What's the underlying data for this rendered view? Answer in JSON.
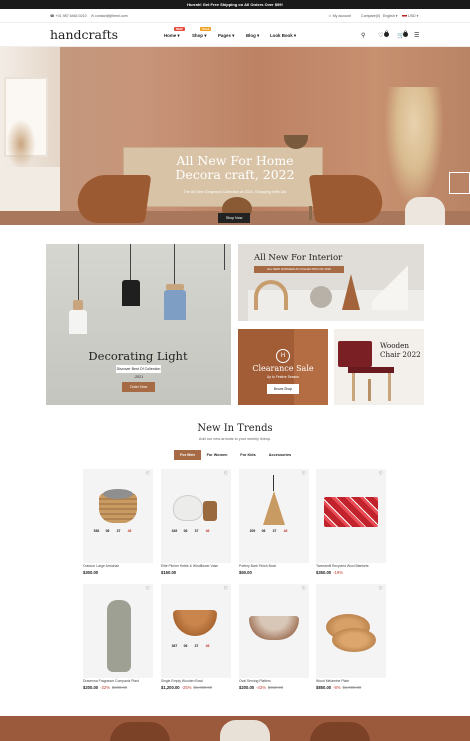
{
  "announcement": "Hurrah! Get Free Shipping on All Orders Over $99!",
  "utility": {
    "phone": "+01 987 6464 0210",
    "email": "contact@jthemi.com",
    "account": "My account",
    "compare": "Compare(0)",
    "language": "English",
    "currency": "USD"
  },
  "header": {
    "logo": "handcrafts",
    "nav": [
      {
        "label": "Home",
        "badge": "NEW",
        "badge_color": "#e74c3c"
      },
      {
        "label": "Shop",
        "badge": "SALE",
        "badge_color": "#f0a020"
      },
      {
        "label": "Pages",
        "badge": ""
      },
      {
        "label": "Blog",
        "badge": ""
      },
      {
        "label": "Look Book",
        "badge": ""
      }
    ],
    "wishlist_count": "0",
    "cart_count": "0"
  },
  "hero": {
    "title": "All New For Home Decora craft, 2022",
    "subtitle": "The All New Gorgeous Collection of 2021, Shopping With Us!",
    "button": "Shop Now"
  },
  "banners": {
    "lighting": {
      "title": "Decorating Light",
      "subtitle": "Discover Best Of Collection -2021",
      "button": "Order Now"
    },
    "interior": {
      "title": "All New For Interior",
      "subtitle": "ALL NEW GORGEOUS COLLECTION OF 2022"
    },
    "clearance": {
      "title": "Clearance Sale",
      "subtitle": "Up to Festive Season",
      "button": "Brows Shop",
      "logo": "H"
    },
    "chair": {
      "title": "Wooden Chair 2022"
    }
  },
  "trends": {
    "title": "New In Trends",
    "subtitle": "Add our new arrivals to your weekly lineup.",
    "tabs": [
      "For Men",
      "For Women",
      "For Kids",
      "Accessories"
    ],
    "active_tab": "For Men",
    "accent": "#a66b44"
  },
  "products": [
    {
      "name": "Outdoor Large Armchair",
      "price": "$300.00",
      "old_price": "",
      "discount": "",
      "countdown": [
        "536",
        "06",
        "37",
        "46"
      ]
    },
    {
      "name": "Elite Pitcher Kettle & Windflower Vase",
      "price": "$150.00",
      "old_price": "",
      "discount": "",
      "countdown": [
        "349",
        "06",
        "37",
        "46"
      ]
    },
    {
      "name": "Pottery Bark Finish Bowl",
      "price": "$50.00",
      "old_price": "",
      "discount": "",
      "countdown": [
        "209",
        "06",
        "37",
        "46"
      ]
    },
    {
      "name": "Tweedmill Recycled Wool Blankets",
      "price": "$350.00",
      "old_price": "",
      "discount": "-19%",
      "countdown": []
    },
    {
      "name": "Dravenna Fragrance Compacts Plant",
      "price": "$200.00",
      "old_price": "$300.00",
      "discount": "-32%",
      "countdown": []
    },
    {
      "name": "Single Empty Wooden Bowl",
      "price": "$1,200.00",
      "old_price": "$1,600.00",
      "discount": "-25%",
      "countdown": [
        "367",
        "06",
        "37",
        "46"
      ]
    },
    {
      "name": "Oval Serving Platters",
      "price": "$200.00",
      "old_price": "$350.00",
      "discount": "-43%",
      "countdown": []
    },
    {
      "name": "Wood Melamine Plate",
      "price": "$850.00",
      "old_price": "$1,000.00",
      "discount": "-8%",
      "countdown": []
    }
  ]
}
